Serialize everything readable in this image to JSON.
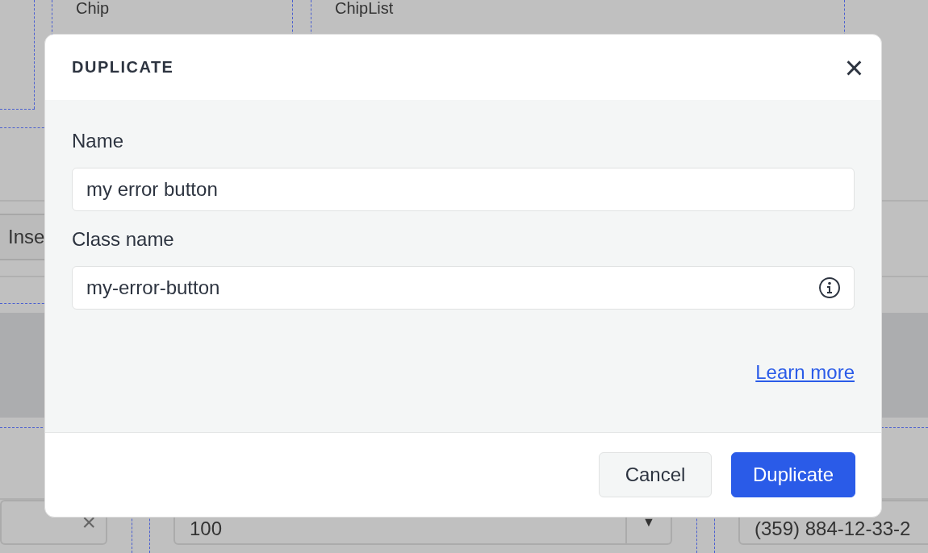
{
  "canvas": {
    "labels": [
      "Chip",
      "ChipList"
    ],
    "button_label": "Inse",
    "fields": [
      {
        "kind": "clearable",
        "clear_glyph": "×"
      },
      {
        "kind": "dropdown",
        "value": "100",
        "caret_glyph": "▼"
      },
      {
        "kind": "plain",
        "value": "(359) 884-12-33-2"
      }
    ]
  },
  "dialog": {
    "title": "DUPLICATE",
    "close_glyph": "×",
    "fields": [
      {
        "label": "Name",
        "value": "my error button",
        "info": false
      },
      {
        "label": "Class name",
        "value": "my-error-button",
        "info": true
      }
    ],
    "link": "Learn more",
    "buttons": [
      {
        "label": "Cancel",
        "kind": "secondary"
      },
      {
        "label": "Duplicate",
        "kind": "primary"
      }
    ]
  }
}
